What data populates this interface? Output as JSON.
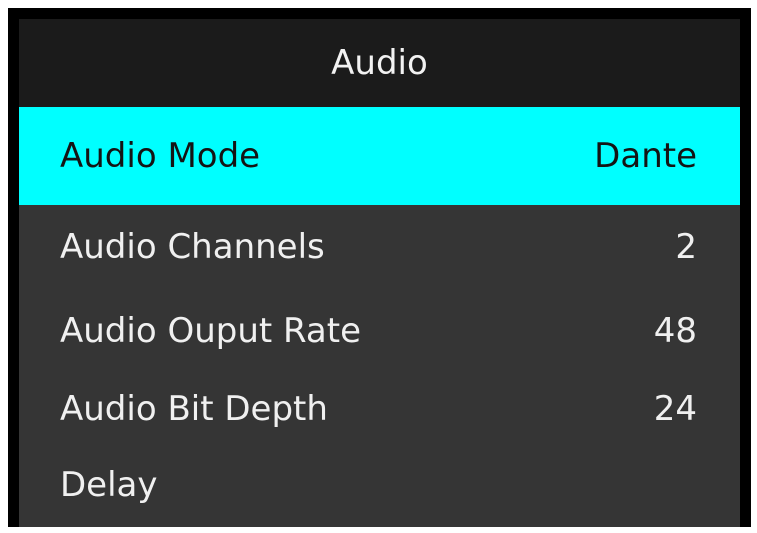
{
  "menu": {
    "title": "Audio",
    "items": [
      {
        "label": "Audio Mode",
        "value": "Dante",
        "selected": true
      },
      {
        "label": "Audio Channels",
        "value": "2",
        "selected": false
      },
      {
        "label": "Audio Ouput Rate",
        "value": "48",
        "selected": false
      },
      {
        "label": "Audio Bit Depth",
        "value": "24",
        "selected": false
      },
      {
        "label": "Delay",
        "value": "",
        "selected": false
      }
    ]
  },
  "colors": {
    "highlight": "#00ffff",
    "title_bg": "#1b1b1b",
    "panel_bg": "#353535",
    "frame": "#000000"
  }
}
